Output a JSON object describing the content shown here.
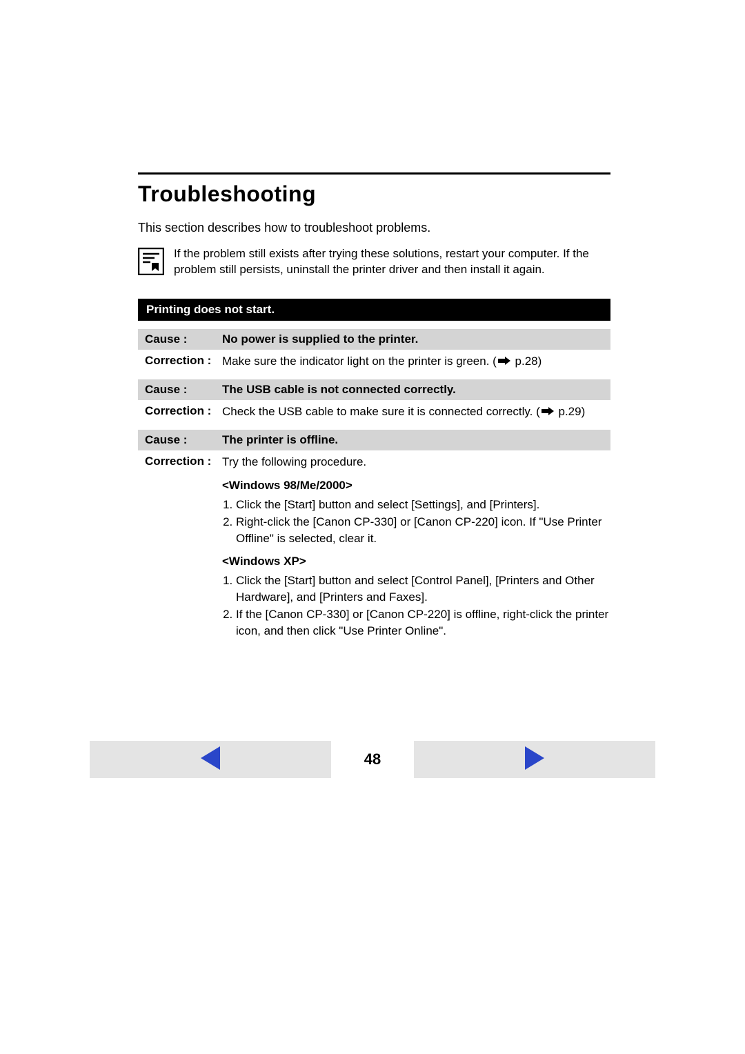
{
  "title": "Troubleshooting",
  "intro": "This section describes how to troubleshoot problems.",
  "note": "If the problem still exists after trying these solutions, restart your computer. If the problem still persists, uninstall the printer driver and then install it again.",
  "section_head": "Printing does not start.",
  "items": [
    {
      "cause_label": "Cause :",
      "cause_text": "No power is supplied to the printer.",
      "corr_label": "Correction :",
      "corr_text_pre": "Make sure the indicator light on the printer is green. (",
      "corr_text_post": " p.28)"
    },
    {
      "cause_label": "Cause :",
      "cause_text": "The USB cable is not connected correctly.",
      "corr_label": "Correction :",
      "corr_text_pre": "Check the USB cable to make sure it is connected correctly. (",
      "corr_text_post": " p.29)"
    },
    {
      "cause_label": "Cause :",
      "cause_text": "The printer is offline.",
      "corr_label": "Correction :",
      "corr_text": "Try the following procedure."
    }
  ],
  "proc1_head": "<Windows 98/Me/2000>",
  "proc1_steps": [
    "Click the [Start] button and select [Settings], and [Printers].",
    "Right-click the [Canon CP-330] or [Canon CP-220] icon. If \"Use Printer Offline\" is selected, clear it."
  ],
  "proc2_head": "<Windows XP>",
  "proc2_steps": [
    "Click the [Start] button and select [Control Panel], [Printers and Other Hardware], and [Printers and Faxes].",
    "If the [Canon CP-330] or [Canon CP-220] is offline, right-click the printer icon, and then click \"Use Printer Online\"."
  ],
  "page_number": "48"
}
